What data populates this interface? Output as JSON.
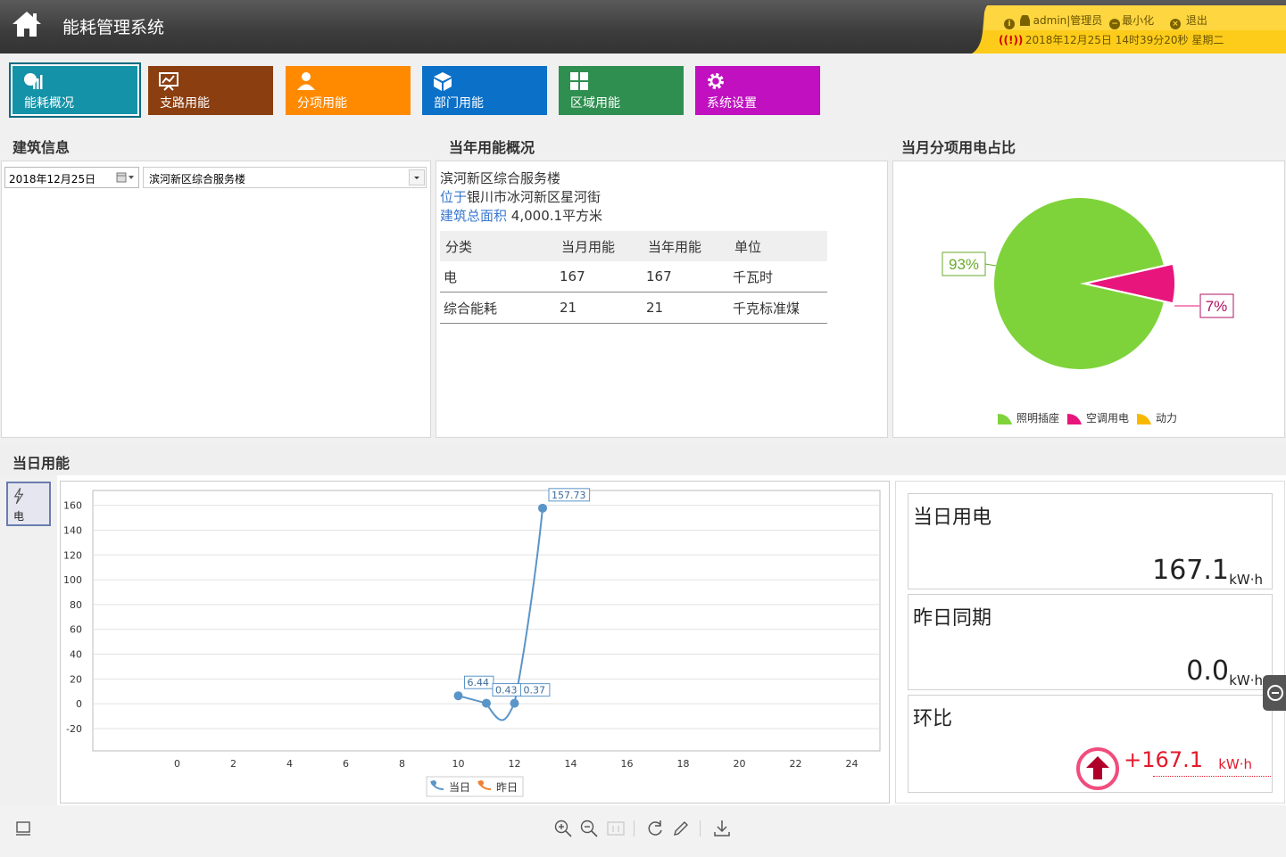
{
  "header": {
    "title": "能耗管理系统",
    "user": "admin|管理员",
    "minimize": "最小化",
    "logout": "退出",
    "datetime": "2018年12月25日 14时39分20秒 星期二"
  },
  "nav": [
    {
      "label": "能耗概况",
      "color": "#1493a8",
      "icon": "overview-icon"
    },
    {
      "label": "支路用能",
      "color": "#8b3e10",
      "icon": "branch-chart-icon"
    },
    {
      "label": "分项用能",
      "color": "#ff8a00",
      "icon": "user-icon"
    },
    {
      "label": "部门用能",
      "color": "#0a70c8",
      "icon": "box-icon"
    },
    {
      "label": "区域用能",
      "color": "#2f8f50",
      "icon": "grid-icon"
    },
    {
      "label": "系统设置",
      "color": "#c010c0",
      "icon": "gear-icon"
    }
  ],
  "building": {
    "title": "建筑信息",
    "date": "2018年12月25日",
    "selected": "滨河新区综合服务楼"
  },
  "yearly": {
    "title": "当年用能概况",
    "name": "滨河新区综合服务楼",
    "loc_key": "位于",
    "loc_val": "银川市冰河新区星河街",
    "area_key": "建筑总面积",
    "area_val": "4,000.1平方米",
    "headers": [
      "分类",
      "当月用能",
      "当年用能",
      "单位"
    ],
    "rows": [
      [
        "电",
        "167",
        "167",
        "千瓦时"
      ],
      [
        "综合能耗",
        "21",
        "21",
        "千克标准煤"
      ]
    ]
  },
  "monthly_pie": {
    "title": "当月分项用电占比",
    "label_big": "93%",
    "label_small": "7%",
    "legend": [
      "照明插座",
      "空调用电",
      "动力"
    ],
    "colors": [
      "#7fd33a",
      "#e8157c",
      "#f9b800"
    ]
  },
  "daily": {
    "title": "当日用能",
    "side_tab": "电",
    "legend_today": "当日",
    "legend_yesterday": "昨日"
  },
  "cards": {
    "today_title": "当日用电",
    "today_value": "167.1",
    "yest_title": "昨日同期",
    "yest_value": "0.0",
    "ratio_title": "环比",
    "ratio_value": "+167.1",
    "unit": "kW·h"
  },
  "chart_data": [
    {
      "type": "pie",
      "categories": [
        "照明插座",
        "空调用电",
        "动力"
      ],
      "values": [
        93,
        7,
        0
      ],
      "labels": [
        "93%",
        "7%"
      ]
    },
    {
      "type": "line",
      "x_ticks": [
        0,
        2,
        4,
        6,
        8,
        10,
        12,
        14,
        16,
        18,
        20,
        22,
        24
      ],
      "y_ticks": [
        -20,
        0,
        20,
        40,
        60,
        80,
        100,
        120,
        140,
        160
      ],
      "xlim": [
        -3,
        25
      ],
      "ylim": [
        -38,
        172
      ],
      "grid": true,
      "legend": "bottom",
      "series": [
        {
          "name": "当日",
          "x": [
            10,
            11,
            12,
            13
          ],
          "y": [
            6.44,
            0.43,
            0.37,
            157.73
          ],
          "labels": [
            "6.44",
            "0.43",
            "0.37",
            "157.73"
          ]
        },
        {
          "name": "昨日",
          "x": [],
          "y": []
        }
      ]
    }
  ]
}
